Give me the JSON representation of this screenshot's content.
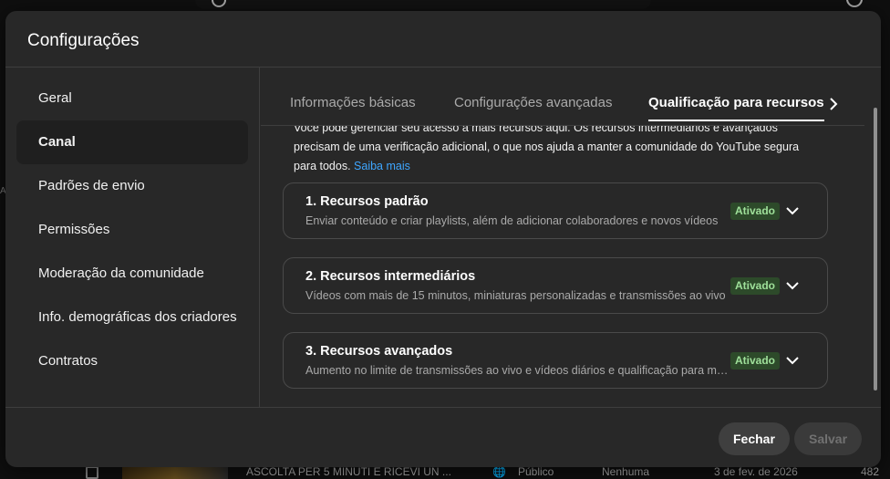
{
  "background": {
    "row": {
      "video_title": "ASCOLTA PER 5 MINUTI E RICEVI UN ...",
      "visibility": "Público",
      "restrictions": "Nenhuma",
      "date": "3 de fev. de 2026",
      "views": "482"
    }
  },
  "dialog": {
    "title": "Configurações",
    "sidebar": {
      "items": [
        {
          "label": "Geral"
        },
        {
          "label": "Canal",
          "active": true
        },
        {
          "label": "Padrões de envio"
        },
        {
          "label": "Permissões"
        },
        {
          "label": "Moderação da comunidade"
        },
        {
          "label": "Info. demográficas dos criadores"
        },
        {
          "label": "Contratos"
        }
      ]
    },
    "tabs": [
      {
        "label": "Informações básicas"
      },
      {
        "label": "Configurações avançadas"
      },
      {
        "label": "Qualificação para recursos",
        "active": true
      }
    ],
    "intro": {
      "text": "Você pode gerenciar seu acesso a mais recursos aqui. Os recursos intermediários e avançados precisam de uma verificação adicional, o que nos ajuda a manter a comunidade do YouTube segura para todos.",
      "link": "Saiba mais"
    },
    "features": [
      {
        "title": "1. Recursos padrão",
        "description": "Enviar conteúdo e criar playlists, além de adicionar colaboradores e novos vídeos",
        "status": "Ativado"
      },
      {
        "title": "2. Recursos intermediários",
        "description": "Vídeos com mais de 15 minutos, miniaturas personalizadas e transmissões ao vivo",
        "status": "Ativado"
      },
      {
        "title": "3. Recursos avançados",
        "description": "Aumento no limite de transmissões ao vivo e vídeos diários e qualificação para mais recursos",
        "status": "Ativado"
      }
    ],
    "footer": {
      "close_label": "Fechar",
      "save_label": "Salvar"
    }
  },
  "colors": {
    "dialog_bg": "#282828",
    "link": "#3ea6ff",
    "badge_bg": "#2d4a2a",
    "badge_text": "#9fe09a"
  }
}
